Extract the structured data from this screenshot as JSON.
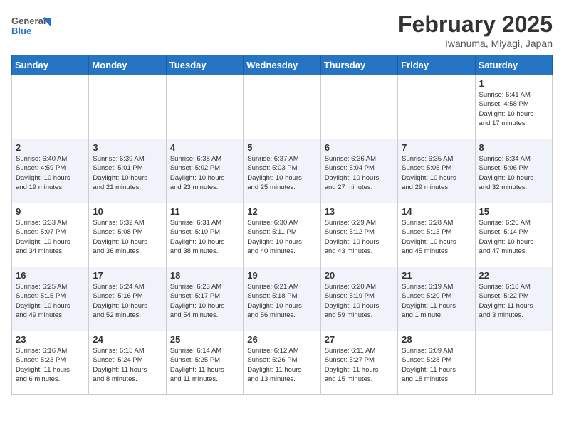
{
  "header": {
    "logo_general": "General",
    "logo_blue": "Blue",
    "month_title": "February 2025",
    "location": "Iwanuma, Miyagi, Japan"
  },
  "weekdays": [
    "Sunday",
    "Monday",
    "Tuesday",
    "Wednesday",
    "Thursday",
    "Friday",
    "Saturday"
  ],
  "weeks": [
    [
      {
        "day": "",
        "info": ""
      },
      {
        "day": "",
        "info": ""
      },
      {
        "day": "",
        "info": ""
      },
      {
        "day": "",
        "info": ""
      },
      {
        "day": "",
        "info": ""
      },
      {
        "day": "",
        "info": ""
      },
      {
        "day": "1",
        "info": "Sunrise: 6:41 AM\nSunset: 4:58 PM\nDaylight: 10 hours\nand 17 minutes."
      }
    ],
    [
      {
        "day": "2",
        "info": "Sunrise: 6:40 AM\nSunset: 4:59 PM\nDaylight: 10 hours\nand 19 minutes."
      },
      {
        "day": "3",
        "info": "Sunrise: 6:39 AM\nSunset: 5:01 PM\nDaylight: 10 hours\nand 21 minutes."
      },
      {
        "day": "4",
        "info": "Sunrise: 6:38 AM\nSunset: 5:02 PM\nDaylight: 10 hours\nand 23 minutes."
      },
      {
        "day": "5",
        "info": "Sunrise: 6:37 AM\nSunset: 5:03 PM\nDaylight: 10 hours\nand 25 minutes."
      },
      {
        "day": "6",
        "info": "Sunrise: 6:36 AM\nSunset: 5:04 PM\nDaylight: 10 hours\nand 27 minutes."
      },
      {
        "day": "7",
        "info": "Sunrise: 6:35 AM\nSunset: 5:05 PM\nDaylight: 10 hours\nand 29 minutes."
      },
      {
        "day": "8",
        "info": "Sunrise: 6:34 AM\nSunset: 5:06 PM\nDaylight: 10 hours\nand 32 minutes."
      }
    ],
    [
      {
        "day": "9",
        "info": "Sunrise: 6:33 AM\nSunset: 5:07 PM\nDaylight: 10 hours\nand 34 minutes."
      },
      {
        "day": "10",
        "info": "Sunrise: 6:32 AM\nSunset: 5:08 PM\nDaylight: 10 hours\nand 36 minutes."
      },
      {
        "day": "11",
        "info": "Sunrise: 6:31 AM\nSunset: 5:10 PM\nDaylight: 10 hours\nand 38 minutes."
      },
      {
        "day": "12",
        "info": "Sunrise: 6:30 AM\nSunset: 5:11 PM\nDaylight: 10 hours\nand 40 minutes."
      },
      {
        "day": "13",
        "info": "Sunrise: 6:29 AM\nSunset: 5:12 PM\nDaylight: 10 hours\nand 43 minutes."
      },
      {
        "day": "14",
        "info": "Sunrise: 6:28 AM\nSunset: 5:13 PM\nDaylight: 10 hours\nand 45 minutes."
      },
      {
        "day": "15",
        "info": "Sunrise: 6:26 AM\nSunset: 5:14 PM\nDaylight: 10 hours\nand 47 minutes."
      }
    ],
    [
      {
        "day": "16",
        "info": "Sunrise: 6:25 AM\nSunset: 5:15 PM\nDaylight: 10 hours\nand 49 minutes."
      },
      {
        "day": "17",
        "info": "Sunrise: 6:24 AM\nSunset: 5:16 PM\nDaylight: 10 hours\nand 52 minutes."
      },
      {
        "day": "18",
        "info": "Sunrise: 6:23 AM\nSunset: 5:17 PM\nDaylight: 10 hours\nand 54 minutes."
      },
      {
        "day": "19",
        "info": "Sunrise: 6:21 AM\nSunset: 5:18 PM\nDaylight: 10 hours\nand 56 minutes."
      },
      {
        "day": "20",
        "info": "Sunrise: 6:20 AM\nSunset: 5:19 PM\nDaylight: 10 hours\nand 59 minutes."
      },
      {
        "day": "21",
        "info": "Sunrise: 6:19 AM\nSunset: 5:20 PM\nDaylight: 11 hours\nand 1 minute."
      },
      {
        "day": "22",
        "info": "Sunrise: 6:18 AM\nSunset: 5:22 PM\nDaylight: 11 hours\nand 3 minutes."
      }
    ],
    [
      {
        "day": "23",
        "info": "Sunrise: 6:16 AM\nSunset: 5:23 PM\nDaylight: 11 hours\nand 6 minutes."
      },
      {
        "day": "24",
        "info": "Sunrise: 6:15 AM\nSunset: 5:24 PM\nDaylight: 11 hours\nand 8 minutes."
      },
      {
        "day": "25",
        "info": "Sunrise: 6:14 AM\nSunset: 5:25 PM\nDaylight: 11 hours\nand 11 minutes."
      },
      {
        "day": "26",
        "info": "Sunrise: 6:12 AM\nSunset: 5:26 PM\nDaylight: 11 hours\nand 13 minutes."
      },
      {
        "day": "27",
        "info": "Sunrise: 6:11 AM\nSunset: 5:27 PM\nDaylight: 11 hours\nand 15 minutes."
      },
      {
        "day": "28",
        "info": "Sunrise: 6:09 AM\nSunset: 5:28 PM\nDaylight: 11 hours\nand 18 minutes."
      },
      {
        "day": "",
        "info": ""
      }
    ]
  ]
}
